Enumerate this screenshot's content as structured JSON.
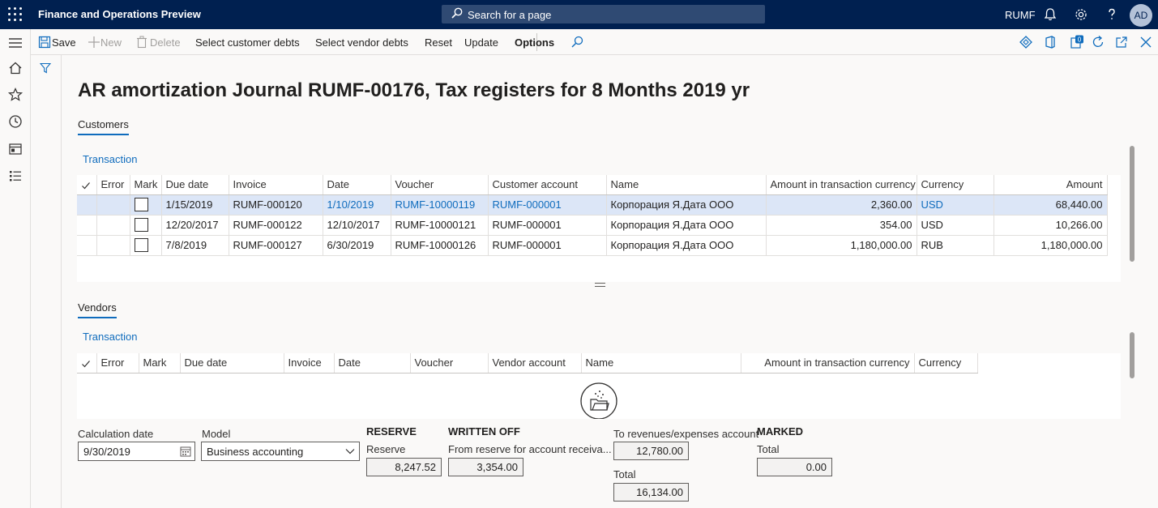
{
  "app": {
    "title": "Finance and Operations Preview",
    "search_placeholder": "Search for a page",
    "company": "RUMF",
    "user_initials": "AD"
  },
  "toolbar": {
    "save": "Save",
    "new": "New",
    "delete": "Delete",
    "select_customer_debts": "Select customer debts",
    "select_vendor_debts": "Select vendor debts",
    "reset": "Reset",
    "update": "Update",
    "options": "Options",
    "badge_count": "0"
  },
  "page": {
    "title": "AR amortization Journal RUMF-00176, Tax registers for 8 Months 2019 yr"
  },
  "customers": {
    "tab": "Customers",
    "link": "Transaction",
    "columns": [
      "Error",
      "Mark",
      "Due date",
      "Invoice",
      "Date",
      "Voucher",
      "Customer account",
      "Name",
      "Amount in transaction currency",
      "Currency",
      "Amount"
    ],
    "rows": [
      {
        "error": "",
        "due_date": "1/15/2019",
        "invoice": "RUMF-000120",
        "date": "1/10/2019",
        "voucher": "RUMF-10000119",
        "account": "RUMF-000001",
        "name": "Корпорация Я.Дата ООО",
        "amount_cur": "2,360.00",
        "currency": "USD",
        "amount": "68,440.00"
      },
      {
        "error": "",
        "due_date": "12/20/2017",
        "invoice": "RUMF-000122",
        "date": "12/10/2017",
        "voucher": "RUMF-10000121",
        "account": "RUMF-000001",
        "name": "Корпорация Я.Дата ООО",
        "amount_cur": "354.00",
        "currency": "USD",
        "amount": "10,266.00"
      },
      {
        "error": "",
        "due_date": "7/8/2019",
        "invoice": "RUMF-000127",
        "date": "6/30/2019",
        "voucher": "RUMF-10000126",
        "account": "RUMF-000001",
        "name": "Корпорация Я.Дата ООО",
        "amount_cur": "1,180,000.00",
        "currency": "RUB",
        "amount": "1,180,000.00"
      }
    ]
  },
  "vendors": {
    "tab": "Vendors",
    "link": "Transaction",
    "columns": [
      "Error",
      "Mark",
      "Due date",
      "Invoice",
      "Date",
      "Voucher",
      "Vendor account",
      "Name",
      "Amount in transaction currency",
      "Currency"
    ]
  },
  "form": {
    "calc_date_label": "Calculation date",
    "calc_date_value": "9/30/2019",
    "model_label": "Model",
    "model_value": "Business accounting",
    "reserve_head": "RESERVE",
    "reserve_label": "Reserve",
    "reserve_value": "8,247.52",
    "written_off_head": "WRITTEN OFF",
    "written_off_label": "From reserve for account receiva...",
    "written_off_value": "3,354.00",
    "to_rev_label": "To revenues/expenses account",
    "to_rev_value": "12,780.00",
    "total_label": "Total",
    "total_value": "16,134.00",
    "marked_head": "MARKED",
    "marked_total_label": "Total",
    "marked_total_value": "0.00"
  }
}
